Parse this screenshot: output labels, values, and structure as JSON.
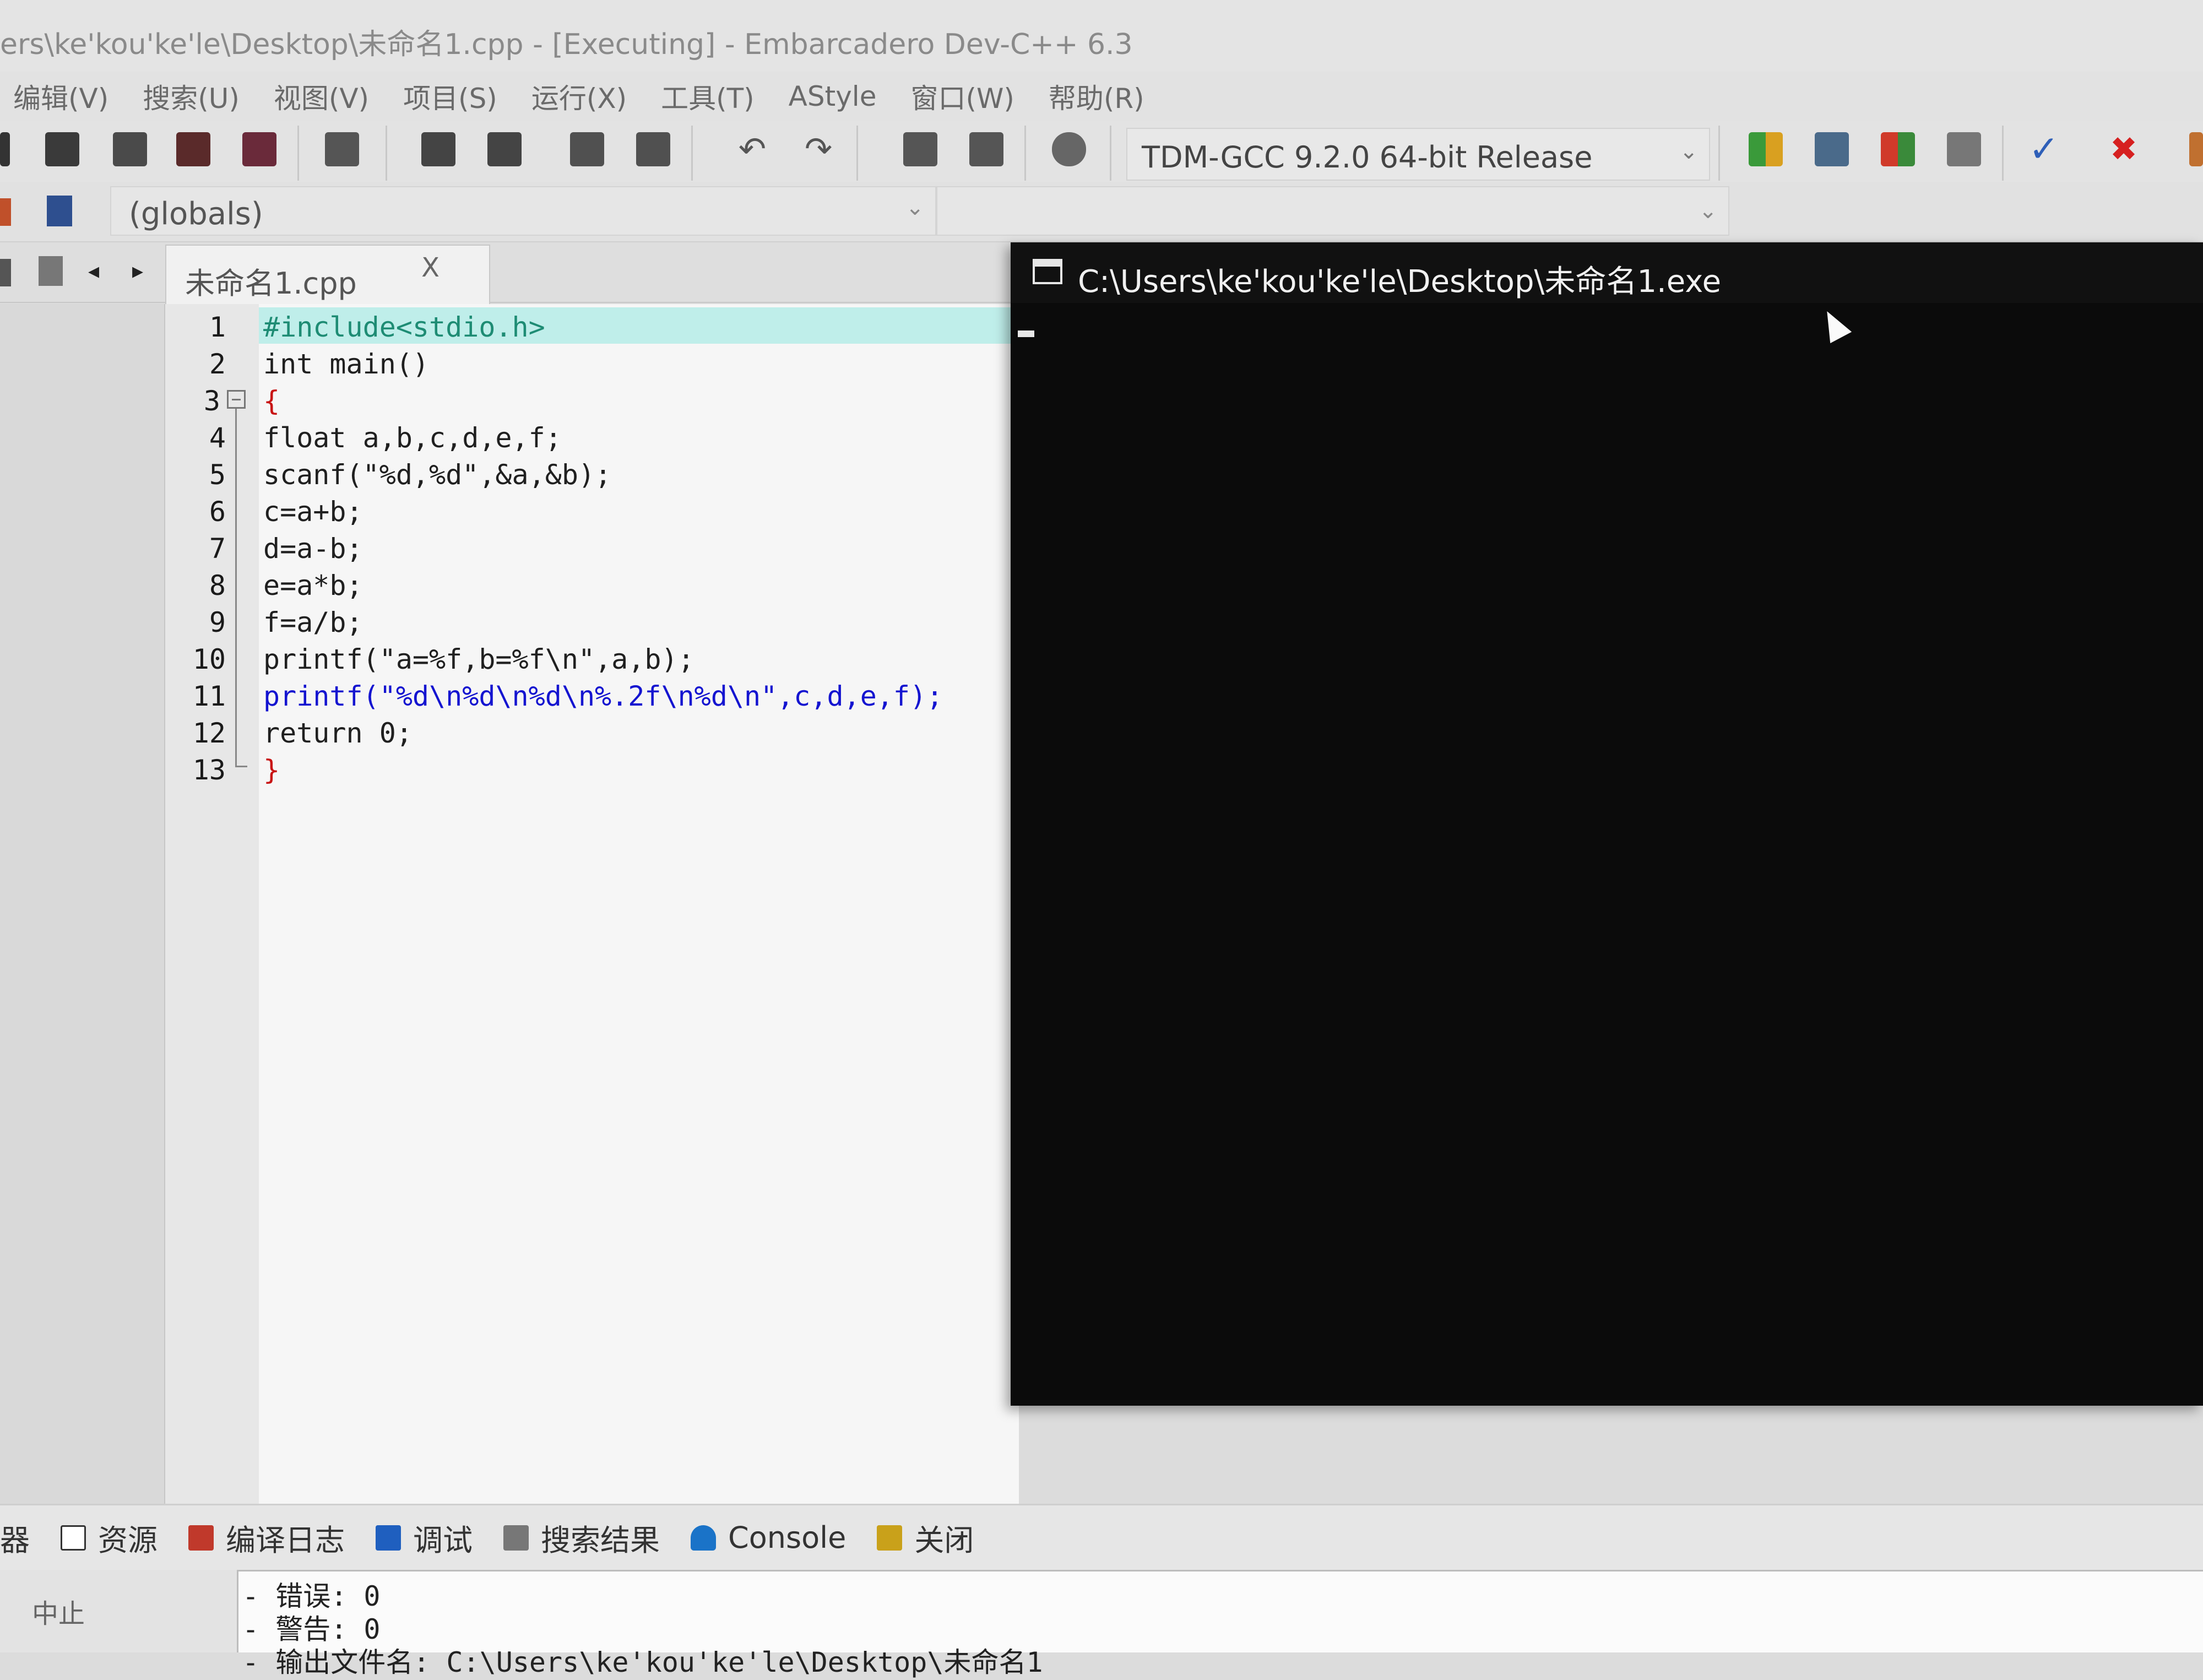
{
  "window": {
    "title": "ers\\ke'kou'ke'le\\Desktop\\未命名1.cpp - [Executing] - Embarcadero Dev-C++ 6.3"
  },
  "menu": [
    "编辑(V)",
    "搜索(U)",
    "视图(V)",
    "项目(S)",
    "运行(X)",
    "工具(T)",
    "AStyle",
    "窗口(W)",
    "帮助(R)"
  ],
  "toolbar": {
    "compiler": "TDM-GCC 9.2.0 64-bit Release",
    "globals": "(globals)"
  },
  "tab": {
    "filename": "未命名1.cpp",
    "close": "X"
  },
  "editor": {
    "lines": [
      {
        "num": "1",
        "code": "#include<stdio.h>"
      },
      {
        "num": "2",
        "code": "int main()"
      },
      {
        "num": "3",
        "code": "{"
      },
      {
        "num": "4",
        "code": "float a,b,c,d,e,f;"
      },
      {
        "num": "5",
        "code": "scanf(\"%d,%d\",&a,&b);"
      },
      {
        "num": "6",
        "code": "c=a+b;"
      },
      {
        "num": "7",
        "code": "d=a-b;"
      },
      {
        "num": "8",
        "code": "e=a*b;"
      },
      {
        "num": "9",
        "code": "f=a/b;"
      },
      {
        "num": "10",
        "code": "printf(\"a=%f,b=%f\\n\",a,b);"
      },
      {
        "num": "11",
        "code": "printf(\"%d\\n%d\\n%d\\n%.2f\\n%d\\n\",c,d,e,f);"
      },
      {
        "num": "12",
        "code": "return 0;"
      },
      {
        "num": "13",
        "code": "}"
      }
    ]
  },
  "console": {
    "title": "C:\\Users\\ke'kou'ke'le\\Desktop\\未命名1.exe"
  },
  "bottom_tabs": [
    {
      "label": "器",
      "icon": "none",
      "color": ""
    },
    {
      "label": "资源",
      "icon": "resource-icon",
      "color": "#ffffff"
    },
    {
      "label": "编译日志",
      "icon": "compile-log-icon",
      "color": "#c0392b"
    },
    {
      "label": "调试",
      "icon": "debug-icon",
      "color": "#1f5fbf"
    },
    {
      "label": "搜索结果",
      "icon": "search-results-icon",
      "color": "#777777"
    },
    {
      "label": "Console",
      "icon": "console-icon",
      "color": "#1a73c8"
    },
    {
      "label": "关闭",
      "icon": "close-panel-icon",
      "color": "#c9a11a"
    }
  ],
  "bottom": {
    "abort": "中止",
    "log": [
      "- 错误: 0",
      "- 警告: 0",
      "- 输出文件名: C:\\Users\\ke'kou'ke'le\\Desktop\\未命名1"
    ]
  }
}
